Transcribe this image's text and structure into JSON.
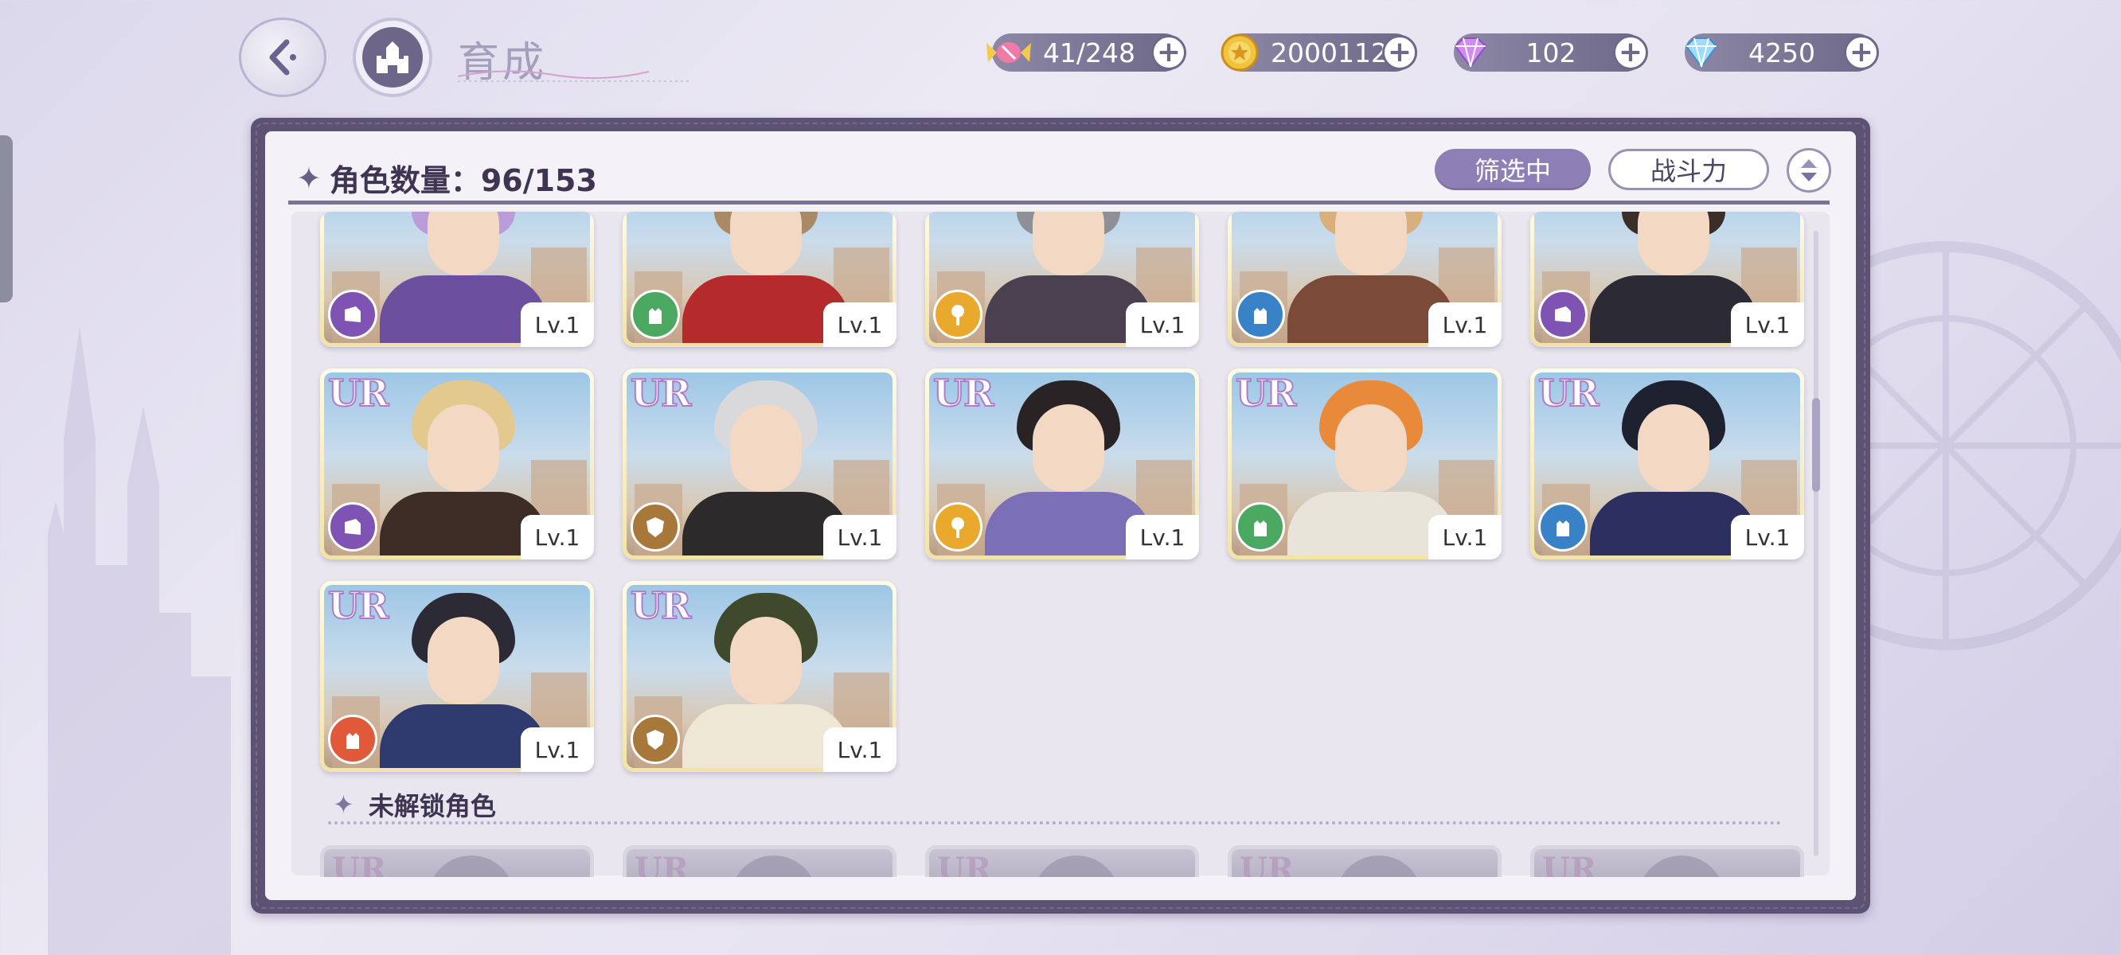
{
  "header": {
    "title": "育成",
    "resources": [
      {
        "name": "candy",
        "value": "41/248",
        "color": "#e0639a"
      },
      {
        "name": "gold-coin",
        "value": "20001120",
        "color": "#e9b531"
      },
      {
        "name": "purple-gem",
        "value": "102",
        "color": "#c777e8"
      },
      {
        "name": "blue-diamond",
        "value": "4250",
        "color": "#6fc3f0"
      }
    ]
  },
  "panel": {
    "count_label": "角色数量：96/153",
    "filter_label": "筛选中",
    "sort_label": "战斗力",
    "unlocked_section_label": "未解锁角色"
  },
  "cards_row1": [
    {
      "level": "Lv.1",
      "type": "purple",
      "hair": "#b99cd8",
      "outfit": "#6d4fa0"
    },
    {
      "level": "Lv.1",
      "type": "green",
      "hair": "#a88a64",
      "outfit": "#b52b2b"
    },
    {
      "level": "Lv.1",
      "type": "yellow",
      "hair": "#8f8f98",
      "outfit": "#4a4050"
    },
    {
      "level": "Lv.1",
      "type": "blue",
      "hair": "#d9b07b",
      "outfit": "#7c4a38"
    },
    {
      "level": "Lv.1",
      "type": "purple",
      "hair": "#3b2d28",
      "outfit": "#2c2a35"
    }
  ],
  "cards_row2": [
    {
      "rarity": "UR",
      "level": "Lv.1",
      "type": "purple",
      "hair": "#e3c98e",
      "outfit": "#3d2d26"
    },
    {
      "rarity": "UR",
      "level": "Lv.1",
      "type": "brown",
      "hair": "#d9d9dc",
      "outfit": "#2d2a2c"
    },
    {
      "rarity": "UR",
      "level": "Lv.1",
      "type": "yellow",
      "hair": "#2a2325",
      "outfit": "#7b6fb8"
    },
    {
      "rarity": "UR",
      "level": "Lv.1",
      "type": "green",
      "hair": "#e88a3a",
      "outfit": "#e9e4da"
    },
    {
      "rarity": "UR",
      "level": "Lv.1",
      "type": "blue",
      "hair": "#1e2130",
      "outfit": "#2d2f60"
    }
  ],
  "cards_row3": [
    {
      "rarity": "UR",
      "level": "Lv.1",
      "type": "red",
      "hair": "#2c2a35",
      "outfit": "#2f3a6e"
    },
    {
      "rarity": "UR",
      "level": "Lv.1",
      "type": "brown",
      "hair": "#3e4a2b",
      "outfit": "#efe7d6"
    }
  ],
  "locked_cards": [
    {
      "rarity": "UR"
    },
    {
      "rarity": "UR"
    },
    {
      "rarity": "UR"
    },
    {
      "rarity": "UR"
    },
    {
      "rarity": "UR"
    }
  ],
  "type_colors": {
    "purple": "#7e53b4",
    "green": "#4aa860",
    "yellow": "#e9a92d",
    "blue": "#3a82c8",
    "brown": "#a8773a",
    "red": "#e05a3a"
  }
}
